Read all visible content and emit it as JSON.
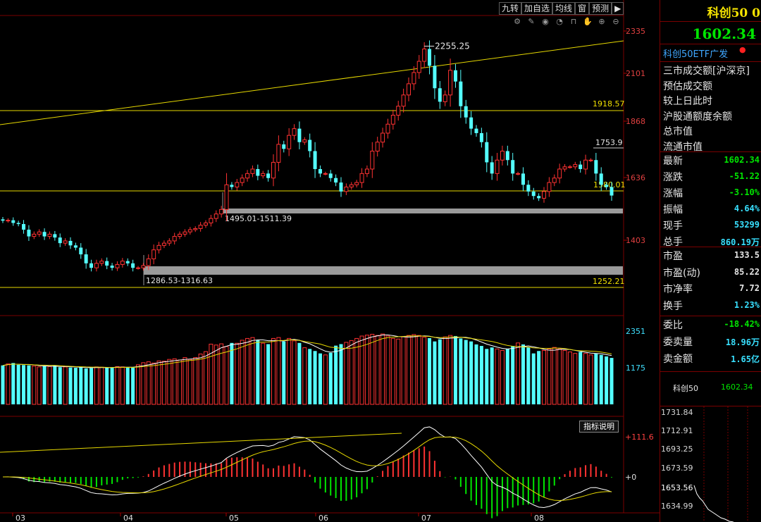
{
  "toolbar": {
    "buttons": [
      "九转",
      "加自选",
      "均线",
      "窗",
      "预测"
    ],
    "arrow": "▶"
  },
  "icons": [
    "gear-icon",
    "pencil-icon",
    "eye-icon",
    "pie-icon",
    "lock-icon",
    "hand-icon",
    "zoom-in-icon",
    "zoom-out-icon"
  ],
  "side": {
    "title": "科创50 0",
    "price": "1602.34",
    "subtitle": "科创50ETF广发",
    "info": [
      "三市成交额[沪深京]",
      "预估成交额",
      "较上日此时",
      "沪股通额度余额",
      "总市值",
      "流通市值"
    ],
    "quote": [
      {
        "label": "最新",
        "value": "1602.34",
        "color": "#00e600"
      },
      {
        "label": "涨跌",
        "value": "-51.22",
        "color": "#00e600"
      },
      {
        "label": "涨幅",
        "value": "-3.10%",
        "color": "#00e600"
      },
      {
        "label": "振幅",
        "value": "4.64%",
        "color": "#38e0ff"
      },
      {
        "label": "现手",
        "value": "53299",
        "color": "#38e0ff"
      },
      {
        "label": "总手",
        "value": "860.19万",
        "color": "#38e0ff"
      }
    ],
    "valuation": [
      {
        "label": "市盈",
        "value": "133.5",
        "color": "#e6e6e6"
      },
      {
        "label": "市盈(动)",
        "value": "85.22",
        "color": "#e6e6e6"
      },
      {
        "label": "市净率",
        "value": "7.72",
        "color": "#e6e6e6"
      },
      {
        "label": "换手",
        "value": "1.23%",
        "color": "#38e0ff"
      }
    ],
    "order": [
      {
        "label": "委比",
        "value": "-18.42%",
        "color": "#00e600"
      },
      {
        "label": "委卖量",
        "value": "18.96万",
        "color": "#38e0ff"
      },
      {
        "label": "卖金额",
        "value": "1.65亿",
        "color": "#38e0ff"
      }
    ],
    "mini_name": "科创50",
    "mini_price": "1602.34",
    "mini_ticks": [
      "1731.84",
      "1712.91",
      "1693.25",
      "1673.59",
      "1653.56",
      "1634.99"
    ]
  },
  "indicator_label": "指标说明",
  "chart_data": {
    "type": "candlestick",
    "months": [
      "03",
      "04",
      "05",
      "06",
      "07",
      "08"
    ],
    "price_axis": [
      "2335",
      "2101",
      "1868",
      "1636",
      "1403"
    ],
    "volume_axis": [
      "2351",
      "1175"
    ],
    "macd_axis": [
      "+111.6",
      "+0"
    ],
    "annotations": {
      "high": "2255.25",
      "level_1918": "1918.57",
      "level_1753": "1753.9",
      "level_1580": "1580.01",
      "level_1252": "1252.21",
      "gap_upper": "1495.01-1511.39",
      "gap_lower": "1286.53-1316.63"
    },
    "close": [
      1490,
      1492,
      1480,
      1475,
      1450,
      1420,
      1430,
      1440,
      1420,
      1430,
      1415,
      1390,
      1400,
      1380,
      1370,
      1340,
      1300,
      1280,
      1300,
      1310,
      1290,
      1280,
      1295,
      1310,
      1300,
      1280,
      1280,
      1290,
      1320,
      1360,
      1380,
      1390,
      1400,
      1420,
      1430,
      1440,
      1450,
      1455,
      1470,
      1480,
      1500,
      1520,
      1540,
      1650,
      1640,
      1660,
      1680,
      1700,
      1720,
      1690,
      1700,
      1680,
      1750,
      1830,
      1810,
      1870,
      1900,
      1840,
      1850,
      1800,
      1720,
      1700,
      1700,
      1680,
      1660,
      1620,
      1640,
      1650,
      1660,
      1700,
      1720,
      1800,
      1840,
      1880,
      1920,
      1960,
      2000,
      2050,
      2100,
      2150,
      2200,
      2255,
      2180,
      2080,
      2020,
      2050,
      2160,
      2110,
      2000,
      1950,
      1900,
      1880,
      1840,
      1750,
      1700,
      1760,
      1800,
      1760,
      1700,
      1700,
      1650,
      1620,
      1600,
      1590,
      1620,
      1660,
      1680,
      1720,
      1730,
      1730,
      1740,
      1720,
      1760,
      1760,
      1700,
      1650,
      1640,
      1602
    ],
    "volume": [
      1300,
      1350,
      1380,
      1320,
      1310,
      1300,
      1280,
      1250,
      1270,
      1260,
      1300,
      1240,
      1250,
      1230,
      1220,
      1260,
      1200,
      1210,
      1250,
      1240,
      1230,
      1220,
      1260,
      1250,
      1240,
      1230,
      1320,
      1390,
      1420,
      1380,
      1450,
      1440,
      1500,
      1520,
      1480,
      1560,
      1500,
      1560,
      1680,
      1760,
      2010,
      1980,
      2020,
      1930,
      2050,
      2040,
      2140,
      2200,
      2230,
      2150,
      2040,
      2010,
      2200,
      2230,
      2100,
      2200,
      2120,
      2050,
      1890,
      1850,
      1780,
      1700,
      1650,
      1720,
      1960,
      2010,
      2070,
      2130,
      2200,
      2280,
      2310,
      2340,
      2300,
      2350,
      2280,
      2200,
      2180,
      2260,
      2300,
      2330,
      2300,
      2240,
      2210,
      2100,
      2170,
      2250,
      2300,
      2280,
      2200,
      2150,
      2100,
      2000,
      1950,
      1850,
      1900,
      1850,
      1800,
      1850,
      1950,
      2050,
      2000,
      1900,
      1700,
      1780,
      1800,
      1850,
      1900,
      1850,
      1800,
      1750,
      1700,
      1750,
      1700,
      1650,
      1700,
      1650,
      1600,
      1550
    ]
  }
}
